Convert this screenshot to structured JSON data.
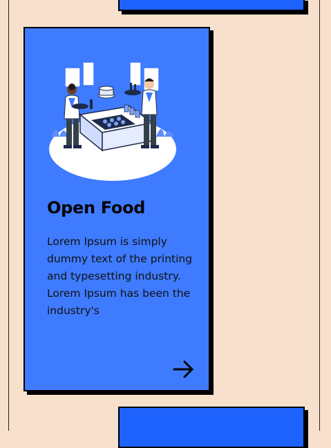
{
  "card": {
    "title": "Open Food",
    "description": "Lorem Ipsum is simply dummy text of the printing and typesetting industry. Lorem Ipsum has been the industry's",
    "arrow_icon": "arrow-right-icon",
    "illustration": "waiters-serving-food-illustration"
  },
  "colors": {
    "page_background": "#f7e0cc",
    "card_background": "#3f7bff",
    "partial_card_background": "#1f63ff",
    "shadow": "#000000"
  }
}
